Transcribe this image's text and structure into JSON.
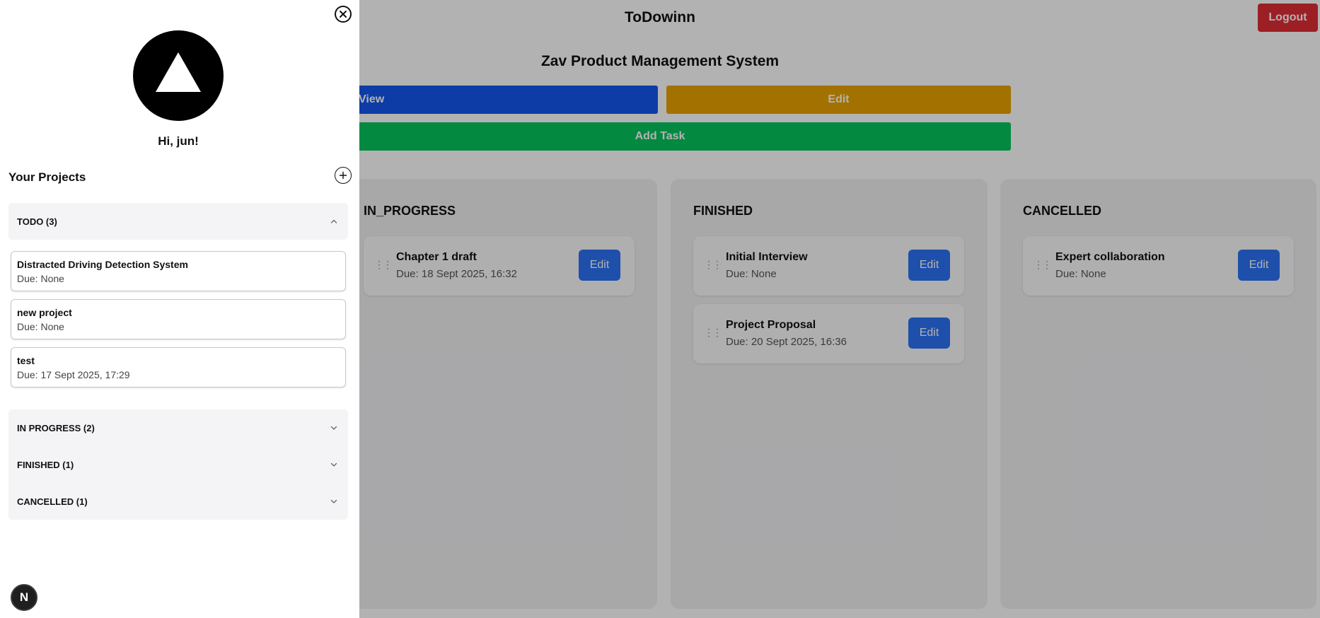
{
  "header": {
    "app_title": "ToDowinn",
    "logout_label": "Logout"
  },
  "project": {
    "title": "Zav Product Management System",
    "view_label": "View",
    "edit_label": "Edit",
    "add_task_label": "Add Task"
  },
  "board": {
    "columns": [
      {
        "title": "IN_PROGRESS",
        "tasks": [
          {
            "name": "Chapter 1 draft",
            "due": "Due: 18 Sept 2025, 16:32",
            "edit_label": "Edit"
          }
        ]
      },
      {
        "title": "FINISHED",
        "tasks": [
          {
            "name": "Initial Interview",
            "due": "Due: None",
            "edit_label": "Edit"
          },
          {
            "name": "Project Proposal",
            "due": "Due: 20 Sept 2025, 16:36",
            "edit_label": "Edit"
          }
        ]
      },
      {
        "title": "CANCELLED",
        "tasks": [
          {
            "name": "Expert collaboration",
            "due": "Due: None",
            "edit_label": "Edit"
          }
        ]
      }
    ]
  },
  "sidebar": {
    "greeting": "Hi, jun!",
    "projects_heading": "Your Projects",
    "groups": [
      {
        "label": "TODO (3)",
        "expanded": true,
        "items": [
          {
            "name": "Distracted Driving Detection System",
            "due": "Due: None"
          },
          {
            "name": "new project",
            "due": "Due: None"
          },
          {
            "name": "test",
            "due": "Due: 17 Sept 2025, 17:29"
          }
        ]
      },
      {
        "label": "IN PROGRESS (2)",
        "expanded": false
      },
      {
        "label": "FINISHED (1)",
        "expanded": false
      },
      {
        "label": "CANCELLED (1)",
        "expanded": false
      }
    ],
    "dev_badge": "N"
  },
  "colors": {
    "logout": "#e02d36",
    "view": "#1456f0",
    "edit_project": "#eaa300",
    "add_task": "#05c55c",
    "task_edit": "#2b72f5",
    "overlay": "rgba(0,0,0,0.30)"
  },
  "icons": {
    "close": "close-circle-icon",
    "add_project": "plus-circle-icon",
    "chevron_up": "chevron-up-icon",
    "chevron_down": "chevron-down-icon",
    "drag": "drag-handle-icon",
    "avatar": "triangle-logo-icon"
  }
}
